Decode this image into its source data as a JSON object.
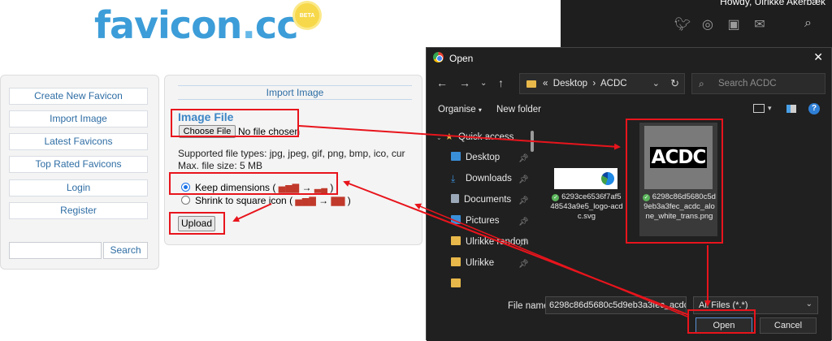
{
  "site": {
    "logo_text": "favicon",
    "logo_dot": ".",
    "logo_tld": "cc",
    "beta": "BETA",
    "nav": [
      {
        "label": "Create New Favicon"
      },
      {
        "label": "Import Image"
      },
      {
        "label": "Latest Favicons"
      },
      {
        "label": "Top Rated Favicons"
      },
      {
        "label": "Login"
      },
      {
        "label": "Register"
      }
    ],
    "search_button": "Search",
    "search_value": ""
  },
  "import": {
    "title": "Import Image",
    "image_file_label": "Image File",
    "choose_file": "Choose File",
    "no_file": "No file chosen",
    "supported": "Supported file types: jpg, jpeg, gif, png, bmp, ico, cur",
    "max_size": "Max. file size: 5 MB",
    "option_keep": "Keep dimensions (",
    "option_shrink": "Shrink to square icon (",
    "close_paren": ")",
    "arrow": "→",
    "upload": "Upload"
  },
  "dark_site": {
    "howdy": "Howdy, Ulrikke Akerbæk",
    "social_icons": [
      "twitter-icon",
      "instagram-icon",
      "linkedin-icon",
      "mail-icon"
    ]
  },
  "dialog": {
    "title": "Open",
    "close": "✕",
    "path": [
      "Desktop",
      "ACDC"
    ],
    "path_separator": "›",
    "path_prefix": "«",
    "search_placeholder": "Search ACDC",
    "organise": "Organise",
    "new_folder": "New folder",
    "help": "?",
    "tree": [
      {
        "label": "Quick access",
        "icon": "star-icon",
        "color": "#e8b84a"
      },
      {
        "label": "Desktop",
        "icon": "desktop-icon",
        "color": "#3a8fd9"
      },
      {
        "label": "Downloads",
        "icon": "download-icon",
        "color": "#3a8fd9"
      },
      {
        "label": "Documents",
        "icon": "documents-icon",
        "color": "#9aa8b8"
      },
      {
        "label": "Pictures",
        "icon": "pictures-icon",
        "color": "#3a8fd9"
      },
      {
        "label": "Ulrikke random",
        "icon": "folder-icon",
        "color": "#e8b84a"
      },
      {
        "label": "Ulrikke",
        "icon": "folder-icon",
        "color": "#e8b84a"
      }
    ],
    "files": [
      {
        "name": "6293ce6536f7af548543a9e5_logo-acdc.svg"
      },
      {
        "name": "6298c86d5680c5d9eb3a3fec_acdc_alone_white_trans.png",
        "thumb_text": "ACDC"
      }
    ],
    "file_name_label": "File name:",
    "file_name_value": "6298c86d5680c5d9eb3a3fec_acdc_a",
    "filter": "All Files (*.*)",
    "open": "Open",
    "cancel": "Cancel"
  },
  "colors": {
    "highlight": "#e8141c",
    "link": "#2e6da4",
    "dark_bg": "#202020"
  }
}
